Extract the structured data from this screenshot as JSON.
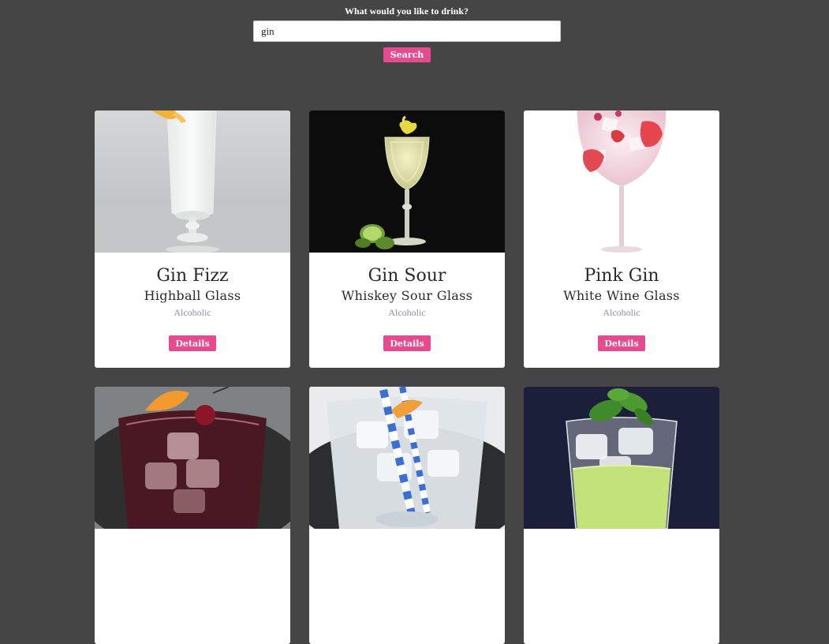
{
  "search": {
    "label": "What would you like to drink?",
    "value": "gin",
    "placeholder": "",
    "button_label": "Search"
  },
  "colors": {
    "background": "#454545",
    "accent": "#e84a8f",
    "card": "#ffffff"
  },
  "results": [
    {
      "name": "Gin Fizz",
      "glass": "Highball Glass",
      "category": "Alcoholic",
      "details_label": "Details",
      "image": "highball-fizz-drink"
    },
    {
      "name": "Gin Sour",
      "glass": "Whiskey Sour Glass",
      "category": "Alcoholic",
      "details_label": "Details",
      "image": "sour-glass-drink"
    },
    {
      "name": "Pink Gin",
      "glass": "White Wine Glass",
      "category": "Alcoholic",
      "details_label": "Details",
      "image": "wine-glass-strawberry-drink"
    },
    {
      "image": "dark-red-rocks-drink"
    },
    {
      "image": "clear-rocks-drink-straws"
    },
    {
      "image": "green-rocks-drink-basil"
    }
  ]
}
